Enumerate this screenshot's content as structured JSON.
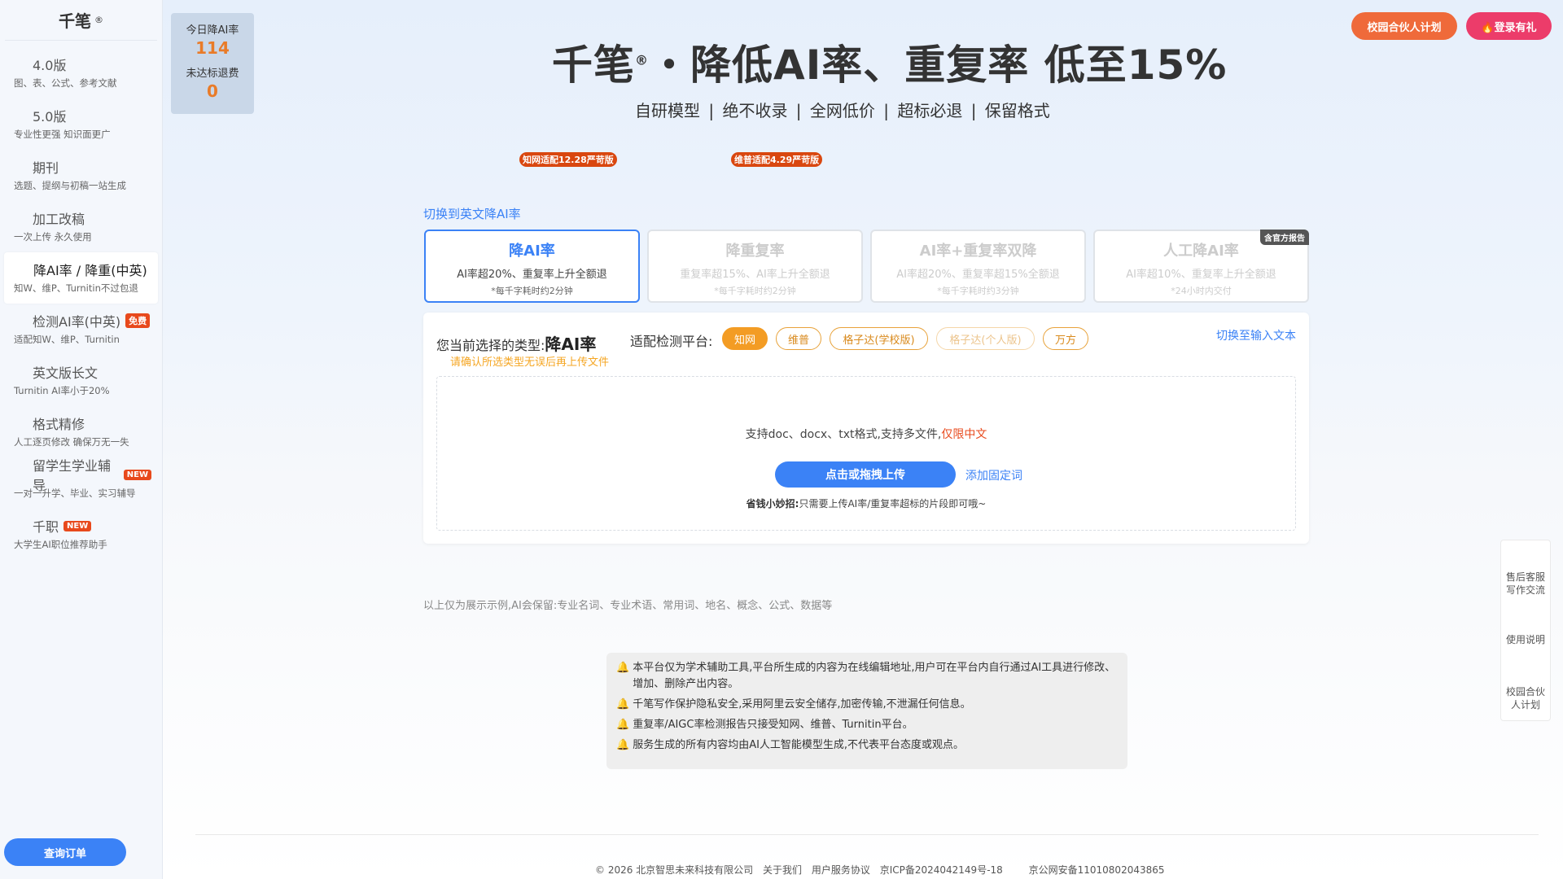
{
  "brand": {
    "name": "千笔",
    "reg": "®"
  },
  "sidebar": {
    "items": [
      {
        "title": "4.0版",
        "sub": "图、表、公式、参考文献"
      },
      {
        "title": "5.0版",
        "sub": "专业性更强 知识面更广"
      },
      {
        "title": "期刊",
        "sub": "选题、提纲与初稿一站生成"
      },
      {
        "title": "加工改稿",
        "sub": "一次上传 永久使用"
      },
      {
        "title": "降AI率 / 降重(中英)",
        "sub": "知W、维P、Turnitin不过包退"
      },
      {
        "title": "检测AI率(中英)",
        "sub": "适配知W、维P、Turnitin",
        "tag": "免费"
      },
      {
        "title": "英文版长文",
        "sub": "Turnitin AI率小于20%"
      },
      {
        "title": "格式精修",
        "sub": "人工逐页修改 确保万无一失"
      },
      {
        "title": "留学生学业辅导",
        "sub": "一对一升学、毕业、实习辅导",
        "tag": "NEW"
      },
      {
        "title": "千职",
        "sub": "大学生AI职位推荐助手",
        "tag": "NEW"
      }
    ],
    "order_button": "查询订单"
  },
  "stats": {
    "today_label": "今日降AI率",
    "today_value": "114",
    "refund_label": "未达标退费",
    "refund_value": "0"
  },
  "header": {
    "title_brand": "千笔",
    "title_reg": "®",
    "title_rest": "・降低AI率、重复率 低至15%",
    "subtitle": "自研模型 | 绝不收录 | 全网低价 | 超标必退  | 保留格式",
    "campus_button": "校园合伙人计划",
    "login_button": "🔥登录有礼",
    "badge_cnki": "知网适配12.28严苛版",
    "badge_vip": "维普适配4.29严苛版"
  },
  "switch_english": "切换到英文降AI率",
  "cards": [
    {
      "title": "降AI率",
      "desc": "AI率超20%、重复率上升全额退",
      "time": "*每千字耗时约2分钟"
    },
    {
      "title": "降重复率",
      "desc": "重复率超15%、AI率上升全额退",
      "time": "*每千字耗时约2分钟"
    },
    {
      "title": "AI率+重复率双降",
      "desc": "AI率超20%、重复率超15%全额退",
      "time": "*每千字耗时约3分钟"
    },
    {
      "title": "人工降AI率",
      "desc": "AI率超10%、重复率上升全额退",
      "time": "*24小时内交付",
      "tag": "含官方报告"
    }
  ],
  "panel": {
    "selected_label": "您当前选择的类型:",
    "selected_value": "降AI率",
    "platform_label": "适配检测平台:",
    "platforms": [
      "知网",
      "维普",
      "格子达(学校版)",
      "格子达(个人版)",
      "万方"
    ],
    "switch_text": "切换至输入文本",
    "warning": "请确认所选类型无误后再上传文件",
    "support_text": "支持doc、docx、txt格式,支持多文件,",
    "support_cn": "仅限中文",
    "upload_button": "点击或拖拽上传",
    "add_word": "添加固定词",
    "tip_bold": "省钱小妙招:",
    "tip_text": "只需要上传AI率/重复率超标的片段即可哦~"
  },
  "example_text": "以上仅为展示示例,AI会保留:专业名词、专业术语、常用词、地名、概念、公式、数据等",
  "notices": [
    "本平台仅为学术辅助工具,平台所生成的内容为在线编辑地址,用户可在平台内自行通过AI工具进行修改、增加、删除产出内容。",
    "千笔写作保护隐私安全,采用阿里云安全储存,加密传输,不泄漏任何信息。",
    "重复率/AIGC率检测报告只接受知网、维普、Turnitin平台。",
    "服务生成的所有内容均由AI人工智能模型生成,不代表平台态度或观点。"
  ],
  "float": {
    "service": "售后客服写作交流",
    "guide": "使用说明",
    "campus": "校园合伙人计划"
  },
  "footer": {
    "copyright": "© 2026 北京智思未来科技有限公司",
    "about": "关于我们",
    "agreement": "用户服务协议",
    "icp": "京ICP备2024042149号-18",
    "police": "京公网安备11010802043865"
  },
  "colors": {
    "accent": "#3b82f6",
    "orange": "#f39c24",
    "red": "#e8491c"
  }
}
